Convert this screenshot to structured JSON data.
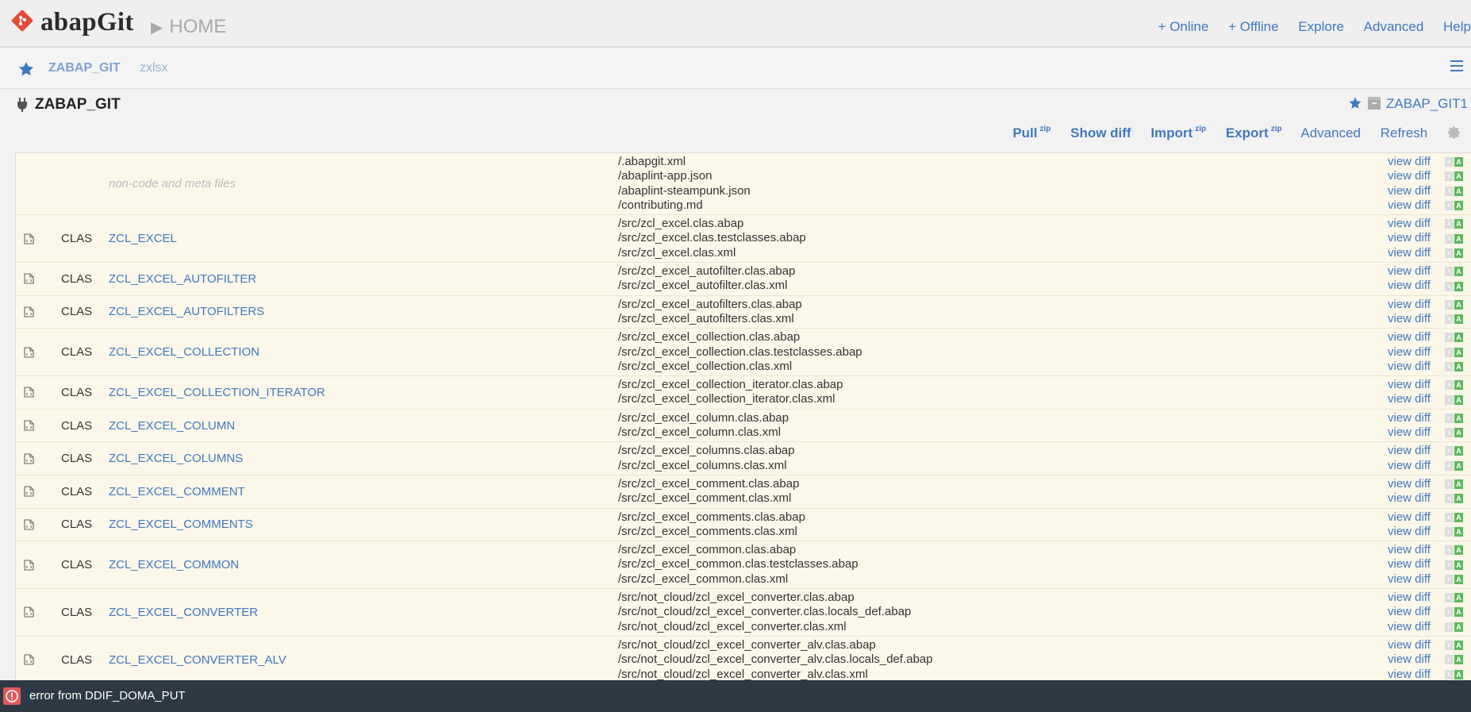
{
  "header": {
    "app_name": "abapGit",
    "page_title": "HOME",
    "nav": [
      "+ Online",
      "+ Offline",
      "Explore",
      "Advanced",
      "Help"
    ]
  },
  "favorites": {
    "active": "ZABAP_GIT",
    "other": "zxlsx"
  },
  "repo": {
    "name": "ZABAP_GIT",
    "package": "ZABAP_GIT1",
    "actions": [
      {
        "label": "Pull",
        "sup": "zip",
        "bold": true
      },
      {
        "label": "Show diff",
        "sup": "",
        "bold": true
      },
      {
        "label": "Import",
        "sup": "zip",
        "bold": true
      },
      {
        "label": "Export",
        "sup": "zip",
        "bold": true
      },
      {
        "label": "Advanced",
        "sup": "",
        "bold": false
      },
      {
        "label": "Refresh",
        "sup": "",
        "bold": false
      }
    ],
    "diff_link": "view diff",
    "flag_x": "x",
    "flag_a": "A"
  },
  "rows": [
    {
      "type": "",
      "name": "non-code and meta files",
      "meta": true,
      "files": [
        "/.abapgit.xml",
        "/abaplint-app.json",
        "/abaplint-steampunk.json",
        "/contributing.md"
      ]
    },
    {
      "type": "CLAS",
      "name": "ZCL_EXCEL",
      "files": [
        "/src/zcl_excel.clas.abap",
        "/src/zcl_excel.clas.testclasses.abap",
        "/src/zcl_excel.clas.xml"
      ]
    },
    {
      "type": "CLAS",
      "name": "ZCL_EXCEL_AUTOFILTER",
      "files": [
        "/src/zcl_excel_autofilter.clas.abap",
        "/src/zcl_excel_autofilter.clas.xml"
      ]
    },
    {
      "type": "CLAS",
      "name": "ZCL_EXCEL_AUTOFILTERS",
      "files": [
        "/src/zcl_excel_autofilters.clas.abap",
        "/src/zcl_excel_autofilters.clas.xml"
      ]
    },
    {
      "type": "CLAS",
      "name": "ZCL_EXCEL_COLLECTION",
      "files": [
        "/src/zcl_excel_collection.clas.abap",
        "/src/zcl_excel_collection.clas.testclasses.abap",
        "/src/zcl_excel_collection.clas.xml"
      ]
    },
    {
      "type": "CLAS",
      "name": "ZCL_EXCEL_COLLECTION_ITERATOR",
      "files": [
        "/src/zcl_excel_collection_iterator.clas.abap",
        "/src/zcl_excel_collection_iterator.clas.xml"
      ]
    },
    {
      "type": "CLAS",
      "name": "ZCL_EXCEL_COLUMN",
      "files": [
        "/src/zcl_excel_column.clas.abap",
        "/src/zcl_excel_column.clas.xml"
      ]
    },
    {
      "type": "CLAS",
      "name": "ZCL_EXCEL_COLUMNS",
      "files": [
        "/src/zcl_excel_columns.clas.abap",
        "/src/zcl_excel_columns.clas.xml"
      ]
    },
    {
      "type": "CLAS",
      "name": "ZCL_EXCEL_COMMENT",
      "files": [
        "/src/zcl_excel_comment.clas.abap",
        "/src/zcl_excel_comment.clas.xml"
      ]
    },
    {
      "type": "CLAS",
      "name": "ZCL_EXCEL_COMMENTS",
      "files": [
        "/src/zcl_excel_comments.clas.abap",
        "/src/zcl_excel_comments.clas.xml"
      ]
    },
    {
      "type": "CLAS",
      "name": "ZCL_EXCEL_COMMON",
      "files": [
        "/src/zcl_excel_common.clas.abap",
        "/src/zcl_excel_common.clas.testclasses.abap",
        "/src/zcl_excel_common.clas.xml"
      ]
    },
    {
      "type": "CLAS",
      "name": "ZCL_EXCEL_CONVERTER",
      "files": [
        "/src/not_cloud/zcl_excel_converter.clas.abap",
        "/src/not_cloud/zcl_excel_converter.clas.locals_def.abap",
        "/src/not_cloud/zcl_excel_converter.clas.xml"
      ]
    },
    {
      "type": "CLAS",
      "name": "ZCL_EXCEL_CONVERTER_ALV",
      "files": [
        "/src/not_cloud/zcl_excel_converter_alv.clas.abap",
        "/src/not_cloud/zcl_excel_converter_alv.clas.locals_def.abap",
        "/src/not_cloud/zcl_excel_converter_alv.clas.xml"
      ]
    }
  ],
  "message": {
    "text": "error from DDIF_DOMA_PUT"
  },
  "icons": {
    "logo": "abapgit-logo-icon",
    "star": "star-icon",
    "menu": "hamburger-menu-icon",
    "plug": "plug-icon",
    "package": "package-icon",
    "gear": "gear-icon",
    "file": "code-file-icon",
    "error": "error-icon"
  },
  "colors": {
    "link": "#4078c0",
    "logo_red": "#e44b3a",
    "table_bg": "#fbf7e9",
    "msg_bg": "#2d3945",
    "flag_green": "#5cb85c"
  }
}
